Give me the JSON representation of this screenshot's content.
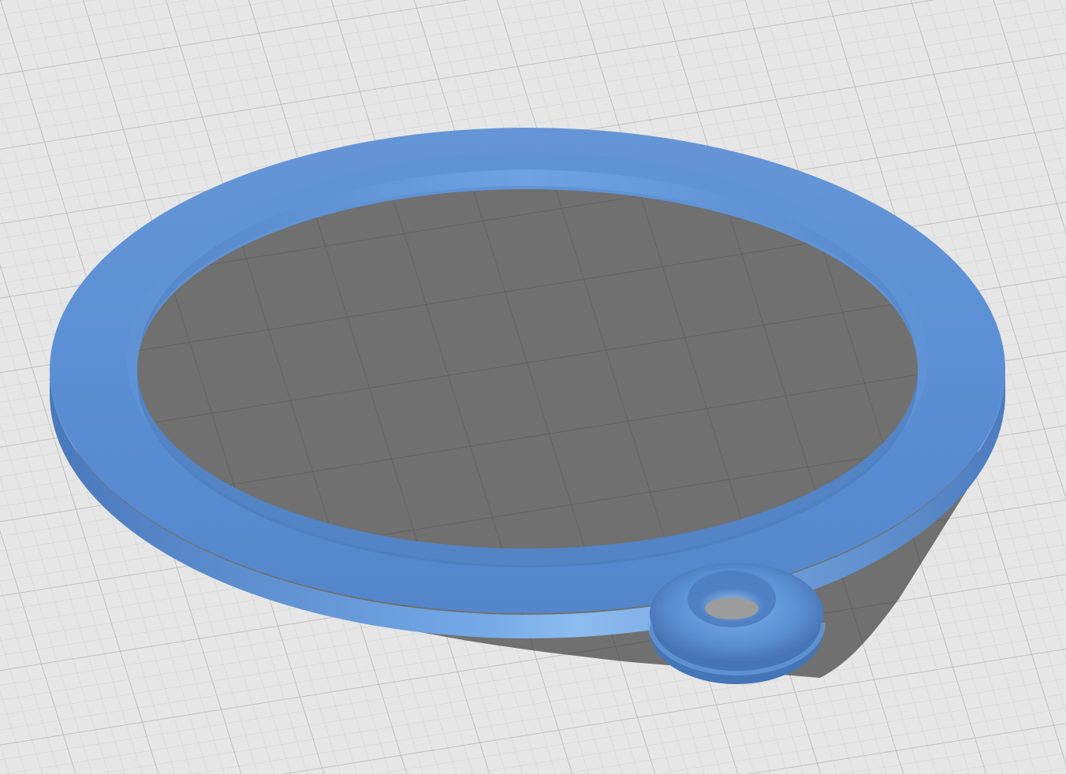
{
  "viewport": {
    "view": "perspective",
    "colors": {
      "background": "#e6e6e6",
      "grid_minor": "#d2d2d2",
      "grid_major": "#b9b9b9",
      "shadow": "#6e6e6e",
      "shadow_grid": "#5e5e5e",
      "model_top": "#5e92d8",
      "model_side": "#4f80c4",
      "model_highlight": "#8ab8ee",
      "model_dark": "#3f6aa8"
    },
    "model": {
      "name": "",
      "shape": "ring-with-hanging-loop",
      "icon": "torus-loop-icon"
    }
  }
}
